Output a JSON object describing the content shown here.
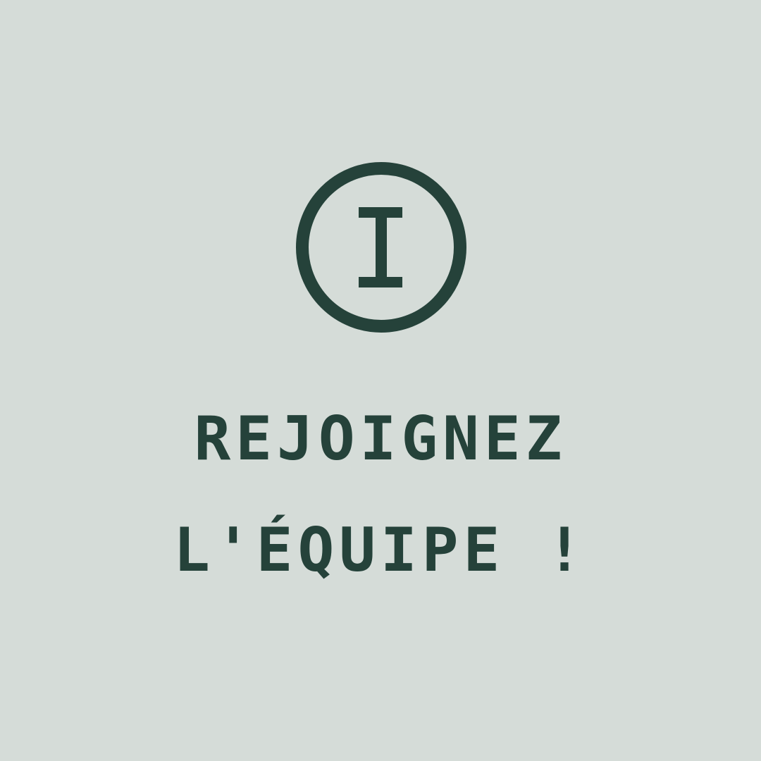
{
  "brand": {
    "logo_icon": "circle-i-logo-icon",
    "color": "#25423a",
    "background": "#d5dcd8"
  },
  "headline": {
    "line1": "REJOIGNEZ",
    "line2": "L'ÉQUIPE !"
  }
}
